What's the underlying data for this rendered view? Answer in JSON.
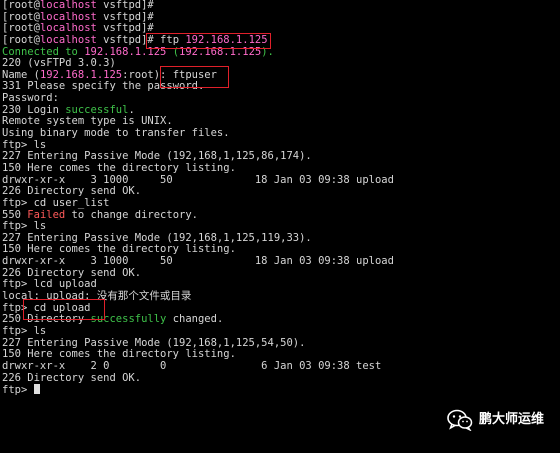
{
  "terminal": {
    "lines": [
      [
        {
          "t": "[root@"
        },
        {
          "t": "localhost",
          "c": "host"
        },
        {
          "t": " vsftpd]#"
        }
      ],
      [
        {
          "t": "[root@"
        },
        {
          "t": "localhost",
          "c": "host"
        },
        {
          "t": " vsftpd]#"
        }
      ],
      [
        {
          "t": "[root@"
        },
        {
          "t": "localhost",
          "c": "host"
        },
        {
          "t": " vsftpd]#"
        }
      ],
      [
        {
          "t": "[root@"
        },
        {
          "t": "localhost",
          "c": "host"
        },
        {
          "t": " vsftpd]# ftp "
        },
        {
          "t": "192.168.1.125",
          "c": "ip"
        }
      ],
      [
        {
          "t": "Connected to ",
          "c": "green"
        },
        {
          "t": "192.168.1.125",
          "c": "ip"
        },
        {
          "t": " (",
          "c": "green"
        },
        {
          "t": "192.168.1.125",
          "c": "ip"
        },
        {
          "t": ").",
          "c": "green"
        }
      ],
      [
        {
          "t": "220 (vsFTPd 3.0.3)"
        }
      ],
      [
        {
          "t": "Name ("
        },
        {
          "t": "192.168.1.125",
          "c": "ip"
        },
        {
          "t": ":root): ftpuser"
        }
      ],
      [
        {
          "t": "331 Please specify the password."
        }
      ],
      [
        {
          "t": "Password:"
        }
      ],
      [
        {
          "t": "230 Login "
        },
        {
          "t": "successful",
          "c": "green"
        },
        {
          "t": "."
        }
      ],
      [
        {
          "t": "Remote system type is UNIX."
        }
      ],
      [
        {
          "t": "Using binary mode to transfer files."
        }
      ],
      [
        {
          "t": "ftp> ls"
        }
      ],
      [
        {
          "t": "227 Entering Passive Mode (192,168,1,125,86,174)."
        }
      ],
      [
        {
          "t": "150 Here comes the directory listing."
        }
      ],
      [
        {
          "t": "drwxr-xr-x    3 1000     50             18 Jan 03 09:38 upload"
        }
      ],
      [
        {
          "t": "226 Directory send OK."
        }
      ],
      [
        {
          "t": "ftp> cd user_list"
        }
      ],
      [
        {
          "t": "550 "
        },
        {
          "t": "Failed",
          "c": "red"
        },
        {
          "t": " to change directory."
        }
      ],
      [
        {
          "t": "ftp> ls"
        }
      ],
      [
        {
          "t": "227 Entering Passive Mode (192,168,1,125,119,33)."
        }
      ],
      [
        {
          "t": "150 Here comes the directory listing."
        }
      ],
      [
        {
          "t": "drwxr-xr-x    3 1000     50             18 Jan 03 09:38 upload"
        }
      ],
      [
        {
          "t": "226 Directory send OK."
        }
      ],
      [
        {
          "t": "ftp> lcd upload"
        }
      ],
      [
        {
          "t": "local: upload: 没有那个文件或目录"
        }
      ],
      [
        {
          "t": "ftp> cd upload"
        }
      ],
      [
        {
          "t": "250 Directory "
        },
        {
          "t": "successfully",
          "c": "green"
        },
        {
          "t": " changed."
        }
      ],
      [
        {
          "t": "ftp> ls"
        }
      ],
      [
        {
          "t": "227 Entering Passive Mode (192,168,1,125,54,50)."
        }
      ],
      [
        {
          "t": "150 Here comes the directory listing."
        }
      ],
      [
        {
          "t": "drwxr-xr-x    2 0        0               6 Jan 03 09:38 test"
        }
      ],
      [
        {
          "t": "226 Directory send OK."
        }
      ],
      [
        {
          "t": "ftp> "
        }
      ]
    ]
  },
  "colors": {
    "background": "#000000",
    "text": "#d6d6d6",
    "host": "#ff6bcb",
    "success": "#3fc24a",
    "error": "#ff5a5a",
    "highlight_box": "#e0202a"
  },
  "watermark": {
    "icon": "wechat-icon",
    "text": "鹏大师运维"
  }
}
